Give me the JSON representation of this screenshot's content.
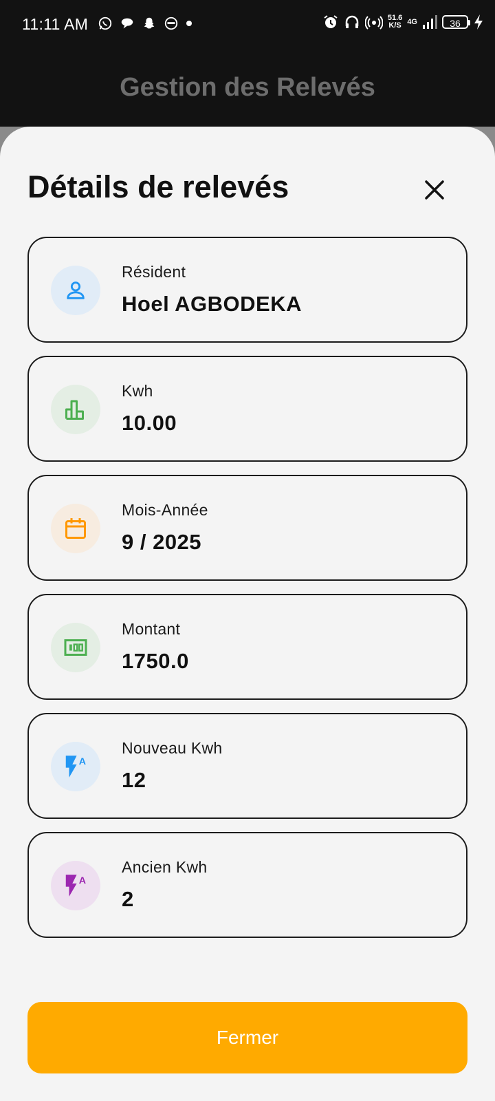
{
  "status_bar": {
    "time": "11:11 AM",
    "speed_value": "51.6",
    "speed_unit": "K/S",
    "network": "4G",
    "battery": "36"
  },
  "app_bar": {
    "title": "Gestion des Relevés"
  },
  "sheet": {
    "title": "Détails de relevés",
    "close_icon": "close-icon",
    "cards": [
      {
        "label": "Résident",
        "value": "Hoel AGBODEKA",
        "icon": "person-icon",
        "icon_color": "#2196f3",
        "icon_bg": "#e1ecf7"
      },
      {
        "label": "Kwh",
        "value": "10.00",
        "icon": "bar-chart-icon",
        "icon_color": "#4caf50",
        "icon_bg": "#e4eee4"
      },
      {
        "label": "Mois-Année",
        "value": "9 / 2025",
        "icon": "calendar-icon",
        "icon_color": "#ff9800",
        "icon_bg": "#f7ece0"
      },
      {
        "label": "Montant",
        "value": "1750.0",
        "icon": "money-icon",
        "icon_color": "#4caf50",
        "icon_bg": "#e4eee4"
      },
      {
        "label": "Nouveau Kwh",
        "value": "12",
        "icon": "flash-auto-icon",
        "icon_color": "#2196f3",
        "icon_bg": "#e1ecf7"
      },
      {
        "label": "Ancien Kwh",
        "value": "2",
        "icon": "flash-auto-icon",
        "icon_color": "#9c27b0",
        "icon_bg": "#eedff0"
      }
    ],
    "close_button_label": "Fermer",
    "button_color": "#ffaa00"
  }
}
